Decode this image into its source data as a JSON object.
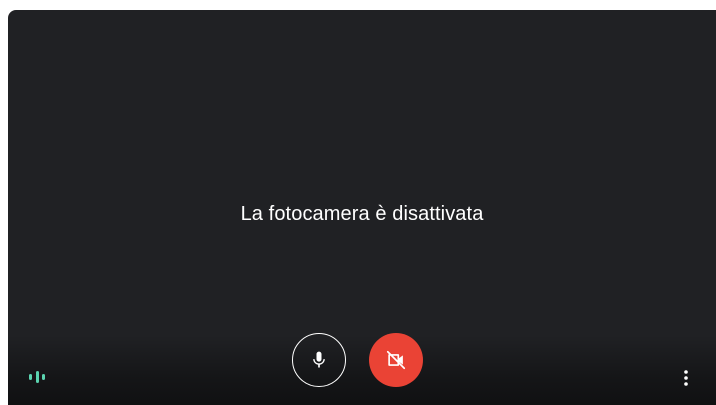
{
  "preview": {
    "message": "La fotocamera è disattivata"
  },
  "controls": {
    "audio_indicator_icon": "audio-level-icon",
    "mic_icon": "microphone-icon",
    "camera_icon": "camera-off-icon",
    "more_icon": "more-vertical-icon"
  },
  "colors": {
    "background": "#202124",
    "camera_off_button": "#ea4335",
    "audio_indicator": "#5bd4b0",
    "text": "#ffffff"
  }
}
